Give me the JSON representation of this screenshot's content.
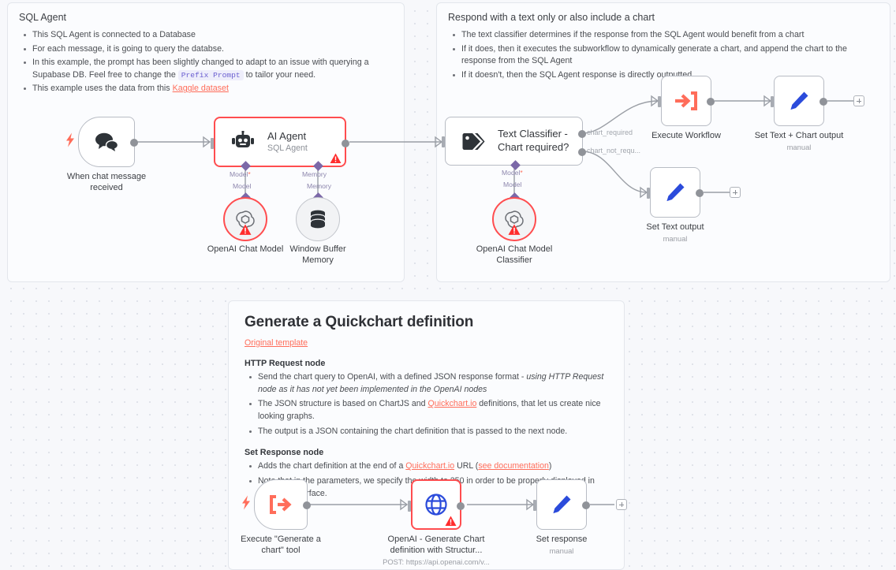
{
  "canvas": {
    "background": "#f7f8fb",
    "grid_dot_color": "#dcdfe7"
  },
  "sticky_notes": [
    {
      "id": "sql-agent",
      "title": "SQL Agent",
      "bullets": [
        {
          "parts": [
            {
              "t": "This SQL Agent is connected to a Database",
              "s": "plain"
            }
          ]
        },
        {
          "parts": [
            {
              "t": "For each message, it is going to query the databse.",
              "s": "plain"
            }
          ]
        },
        {
          "parts": [
            {
              "t": "In this example, the prompt has been slightly changed to adapt to an issue with querying a Supabase DB. Feel free to change the ",
              "s": "plain"
            },
            {
              "t": "Prefix Prompt",
              "s": "code"
            },
            {
              "t": " to tailor your need.",
              "s": "plain"
            }
          ]
        },
        {
          "parts": [
            {
              "t": "This example uses the data from this ",
              "s": "plain"
            },
            {
              "t": "Kaggle dataset",
              "s": "link"
            }
          ]
        }
      ]
    },
    {
      "id": "respond-chart",
      "title": "Respond with a text only or also include a chart",
      "bullets": [
        {
          "parts": [
            {
              "t": "The text classifier determines if the response from the SQL Agent would benefit from a chart",
              "s": "plain"
            }
          ]
        },
        {
          "parts": [
            {
              "t": "If it does, then it executes the subworkflow to dynamically generate a chart, and append the chart to the response from the SQL Agent",
              "s": "plain"
            }
          ]
        },
        {
          "parts": [
            {
              "t": "If it doesn't, then the SQL Agent response is directly outputted.",
              "s": "plain"
            }
          ]
        }
      ]
    }
  ],
  "quickchart_note": {
    "title": "Generate a Quickchart definition",
    "original_template_link": "Original template",
    "section1_heading": "HTTP Request node",
    "section1_bullets": [
      {
        "parts": [
          {
            "t": "Send the chart query to OpenAI, with a defined JSON response format - ",
            "s": "plain"
          },
          {
            "t": "using HTTP Request node as it has not yet been implemented in the OpenAI nodes",
            "s": "italic"
          }
        ]
      },
      {
        "parts": [
          {
            "t": "The JSON structure is based on ChartJS and ",
            "s": "plain"
          },
          {
            "t": "Quickchart.io",
            "s": "link"
          },
          {
            "t": " definitions, that let us create nice looking graphs.",
            "s": "plain"
          }
        ]
      },
      {
        "parts": [
          {
            "t": "The output is a JSON containing the chart definition that is passed to the next node.",
            "s": "plain"
          }
        ]
      }
    ],
    "section2_heading": "Set Response node",
    "section2_bullets": [
      {
        "parts": [
          {
            "t": "Adds the chart definition at the end of a ",
            "s": "plain"
          },
          {
            "t": "Quickchart.io",
            "s": "link"
          },
          {
            "t": " URL (",
            "s": "plain"
          },
          {
            "t": "see documentation",
            "s": "link"
          },
          {
            "t": ")",
            "s": "plain"
          }
        ]
      },
      {
        "parts": [
          {
            "t": "Note that in the parameters, we specify the width to 250 in order to be properly displayed in the chart interface.",
            "s": "plain"
          }
        ]
      }
    ]
  },
  "nodes": {
    "chat_trigger": {
      "label": "When chat message received",
      "icon": "chat-bubbles-icon"
    },
    "ai_agent": {
      "title": "AI Agent",
      "subtitle": "SQL Agent",
      "icon": "robot-icon",
      "state": "error"
    },
    "openai_chat_model": {
      "label": "OpenAI Chat Model",
      "icon": "openai-icon",
      "state": "error"
    },
    "window_buffer": {
      "label": "Window Buffer Memory",
      "icon": "database-icon",
      "state": "ok"
    },
    "text_classifier": {
      "title": "Text Classifier -",
      "title2": "Chart required?",
      "icon": "tag-icon",
      "state": "ok"
    },
    "openai_classifier": {
      "label": "OpenAI Chat Model Classifier",
      "icon": "openai-icon",
      "state": "error"
    },
    "execute_workflow": {
      "label": "Execute Workflow",
      "icon": "arrow-into-bracket-icon"
    },
    "set_text_chart": {
      "label": "Set Text + Chart output",
      "sublabel": "manual",
      "icon": "pencil-icon"
    },
    "set_text": {
      "label": "Set Text output",
      "sublabel": "manual",
      "icon": "pencil-icon"
    },
    "exec_chart_tool": {
      "label": "Execute \"Generate a chart\" tool",
      "icon": "arrow-out-bracket-icon"
    },
    "openai_http": {
      "label": "OpenAI - Generate Chart definition with Structur...",
      "sublabel": "POST: https://api.openai.com/v...",
      "icon": "globe-icon",
      "state": "error"
    },
    "set_response": {
      "label": "Set response",
      "sublabel": "manual",
      "icon": "pencil-icon"
    }
  },
  "ports": {
    "model_required": "Model",
    "model_plain": "Model",
    "memory_top": "Memory",
    "memory_bottom": "Memory",
    "chart_required": "chart_required",
    "chart_not_required": "chart_not_requ..."
  },
  "colors": {
    "error": "#ff4d4f",
    "link": "#ff6d5a",
    "accent_orange": "#ff6d5a",
    "accent_blue": "#2b4bdb",
    "port_purple": "#7b68a8",
    "edge": "#9a9ea5"
  }
}
